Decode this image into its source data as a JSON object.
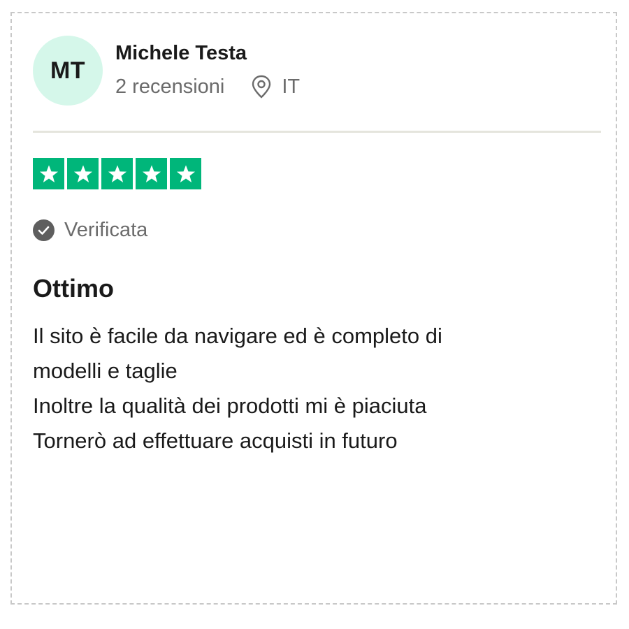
{
  "reviewer": {
    "initials": "MT",
    "name": "Michele Testa",
    "reviews_count": "2 recensioni",
    "country": "IT",
    "avatar_color": "#d5f7ea"
  },
  "rating": {
    "stars": 5,
    "max": 5,
    "color": "#00b67a"
  },
  "verified_label": "Verificata",
  "review": {
    "title": "Ottimo",
    "lines": [
      "Il sito è facile da navigare ed è completo di",
      "modelli e taglie",
      "Inoltre la qualità dei prodotti mi è piaciuta",
      "Tornerò ad effettuare acquisti in futuro"
    ]
  },
  "icons": {
    "location": "map-pin-icon",
    "verified": "check-circle-icon",
    "star": "star-icon"
  }
}
